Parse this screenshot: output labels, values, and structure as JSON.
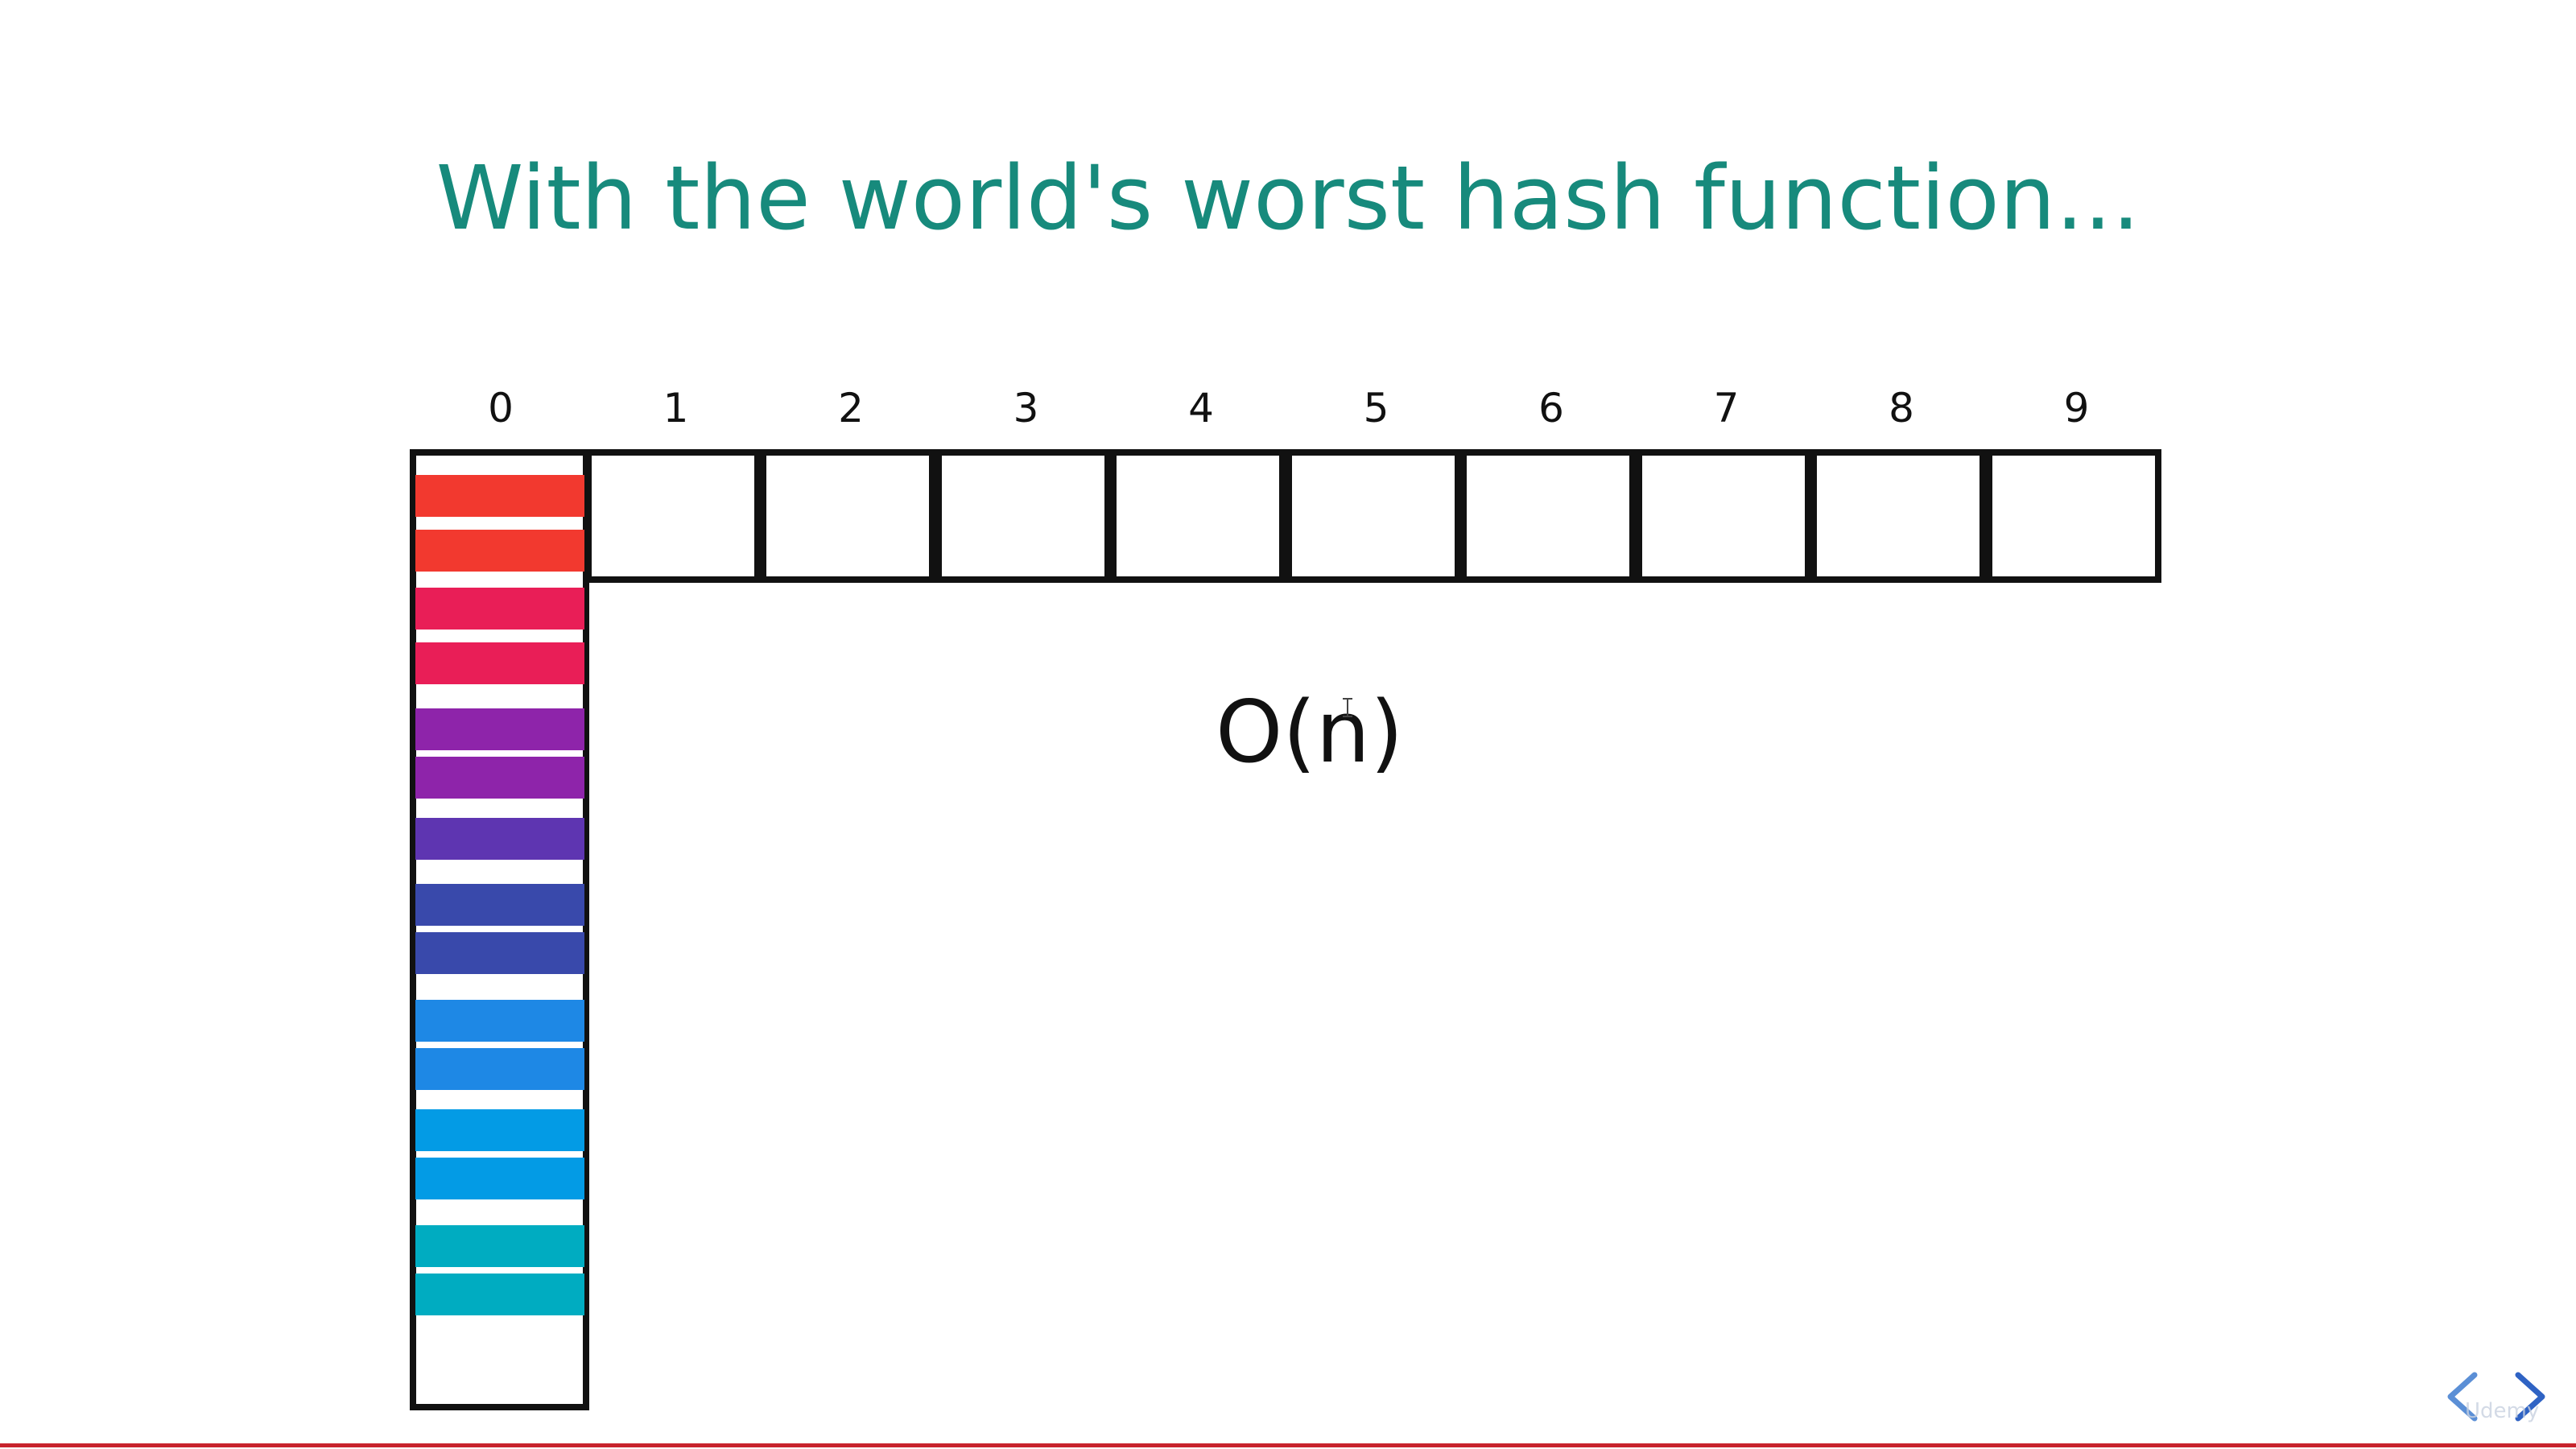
{
  "slide": {
    "title": "With the world's worst hash function...",
    "title_color": "#178a7c",
    "complexity_label": "O(n)"
  },
  "hash_table": {
    "indices": [
      "0",
      "1",
      "2",
      "3",
      "4",
      "5",
      "6",
      "7",
      "8",
      "9"
    ],
    "bucket_0_entry_count": 15,
    "bucket_0_entry_colors": [
      "#f2392f",
      "#f2392f",
      "#e91e57",
      "#e91e57",
      "#8e24aa",
      "#8e24aa",
      "#5e35b1",
      "#3949ab",
      "#3949ab",
      "#1e88e5",
      "#1e88e5",
      "#039be5",
      "#039be5",
      "#00acc1",
      "#00acc1"
    ]
  },
  "navigation": {
    "prev_icon": "chevron-left-icon",
    "next_icon": "chevron-right-icon",
    "accent_color": "#5b8fd6"
  },
  "watermark": {
    "text": "Udemy"
  }
}
